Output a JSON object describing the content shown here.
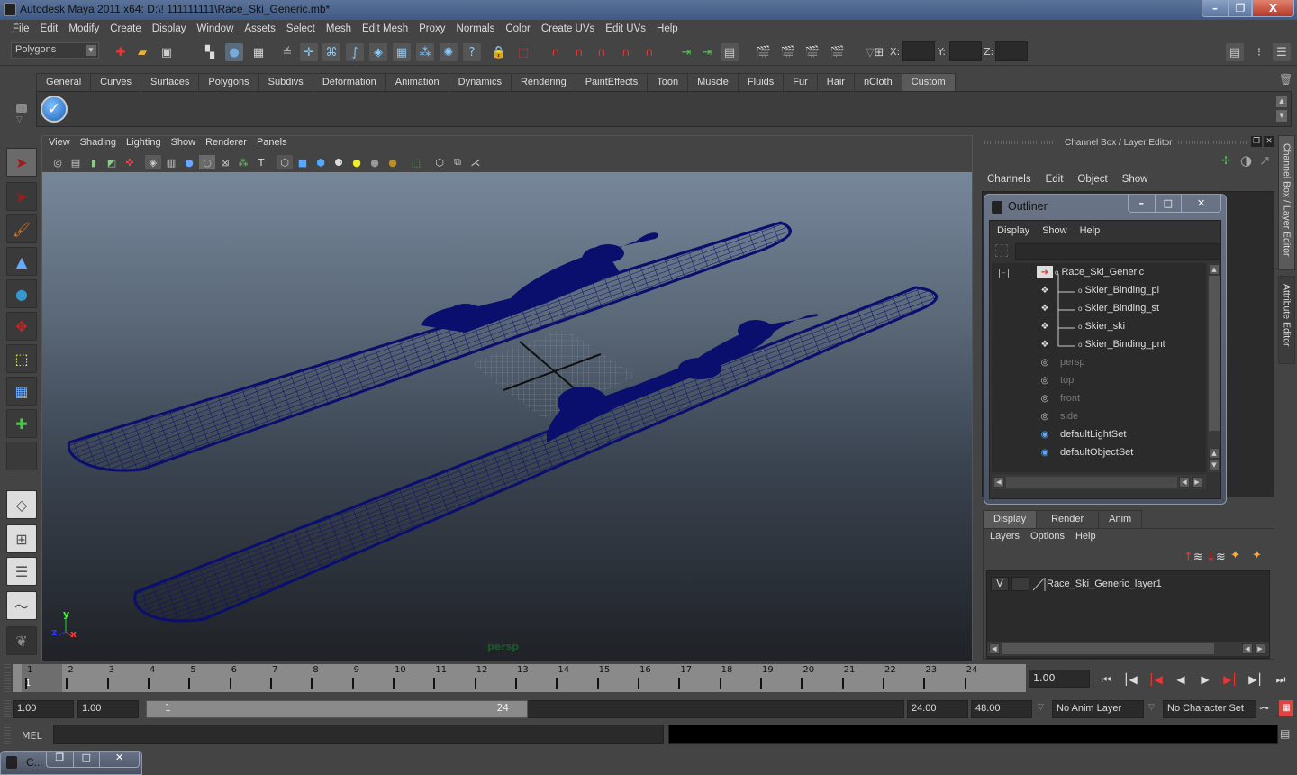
{
  "window": {
    "title": "Autodesk Maya 2011 x64: D:\\! 111111111\\Race_Ski_Generic.mb*",
    "minimize": "–",
    "restore": "❐",
    "close": "X"
  },
  "menubar": [
    "File",
    "Edit",
    "Modify",
    "Create",
    "Display",
    "Window",
    "Assets",
    "Select",
    "Mesh",
    "Edit Mesh",
    "Proxy",
    "Normals",
    "Color",
    "Create UVs",
    "Edit UVs",
    "Help"
  ],
  "statusline": {
    "mode": "Polygons",
    "x_label": "X:",
    "y_label": "Y:",
    "z_label": "Z:",
    "x_value": "",
    "y_value": "",
    "z_value": ""
  },
  "shelf": {
    "tabs": [
      "General",
      "Curves",
      "Surfaces",
      "Polygons",
      "Subdivs",
      "Deformation",
      "Animation",
      "Dynamics",
      "Rendering",
      "PaintEffects",
      "Toon",
      "Muscle",
      "Fluids",
      "Fur",
      "Hair",
      "nCloth",
      "Custom"
    ],
    "active_tab": "Custom"
  },
  "viewport": {
    "menu": [
      "View",
      "Shading",
      "Lighting",
      "Show",
      "Renderer",
      "Panels"
    ],
    "camera_label": "persp",
    "axis": {
      "x": "x",
      "y": "y",
      "z": "z"
    },
    "wire_color": "#0a0f6e"
  },
  "channel_box": {
    "title": "Channel Box / Layer Editor",
    "menu": [
      "Channels",
      "Edit",
      "Object",
      "Show"
    ]
  },
  "outliner": {
    "title": "Outliner",
    "menu": [
      "Display",
      "Show",
      "Help"
    ],
    "filter": "",
    "items": [
      {
        "name": "Race_Ski_Generic",
        "icon": "group-icon",
        "dim": false
      },
      {
        "name": "Skier_Binding_pl",
        "icon": "mesh-icon",
        "dim": false
      },
      {
        "name": "Skier_Binding_st",
        "icon": "mesh-icon",
        "dim": false
      },
      {
        "name": "Skier_ski",
        "icon": "mesh-icon",
        "dim": false
      },
      {
        "name": "Skier_Binding_pnt",
        "icon": "mesh-icon",
        "dim": false
      },
      {
        "name": "persp",
        "icon": "camera-icon",
        "dim": true
      },
      {
        "name": "top",
        "icon": "camera-icon",
        "dim": true
      },
      {
        "name": "front",
        "icon": "camera-icon",
        "dim": true
      },
      {
        "name": "side",
        "icon": "camera-icon",
        "dim": true
      },
      {
        "name": "defaultLightSet",
        "icon": "set-icon",
        "dim": false
      },
      {
        "name": "defaultObjectSet",
        "icon": "set-icon",
        "dim": false
      }
    ]
  },
  "layer_editor": {
    "tabs": [
      "Display",
      "Render",
      "Anim"
    ],
    "active_tab": "Display",
    "menu": [
      "Layers",
      "Options",
      "Help"
    ],
    "layers": [
      {
        "visible": "V",
        "name": "Race_Ski_Generic_layer1"
      }
    ]
  },
  "side_tabs": [
    "Channel Box / Layer Editor",
    "Attribute Editor"
  ],
  "timeline": {
    "ticks": [
      "1",
      "2",
      "3",
      "4",
      "5",
      "6",
      "7",
      "8",
      "9",
      "10",
      "11",
      "12",
      "13",
      "14",
      "15",
      "16",
      "17",
      "18",
      "19",
      "20",
      "21",
      "22",
      "23",
      "24"
    ],
    "current_marker": "1",
    "current_frame": "1.00"
  },
  "range": {
    "start_time": "1.00",
    "playback_start": "1.00",
    "range_start": "1",
    "range_end": "24",
    "playback_end": "24.00",
    "end_time": "48.00",
    "anim_layer": "No Anim Layer",
    "character_set": "No Character Set"
  },
  "command_line": {
    "label": "MEL",
    "input": "",
    "output": ""
  },
  "minimized_window": {
    "title": "C..."
  }
}
